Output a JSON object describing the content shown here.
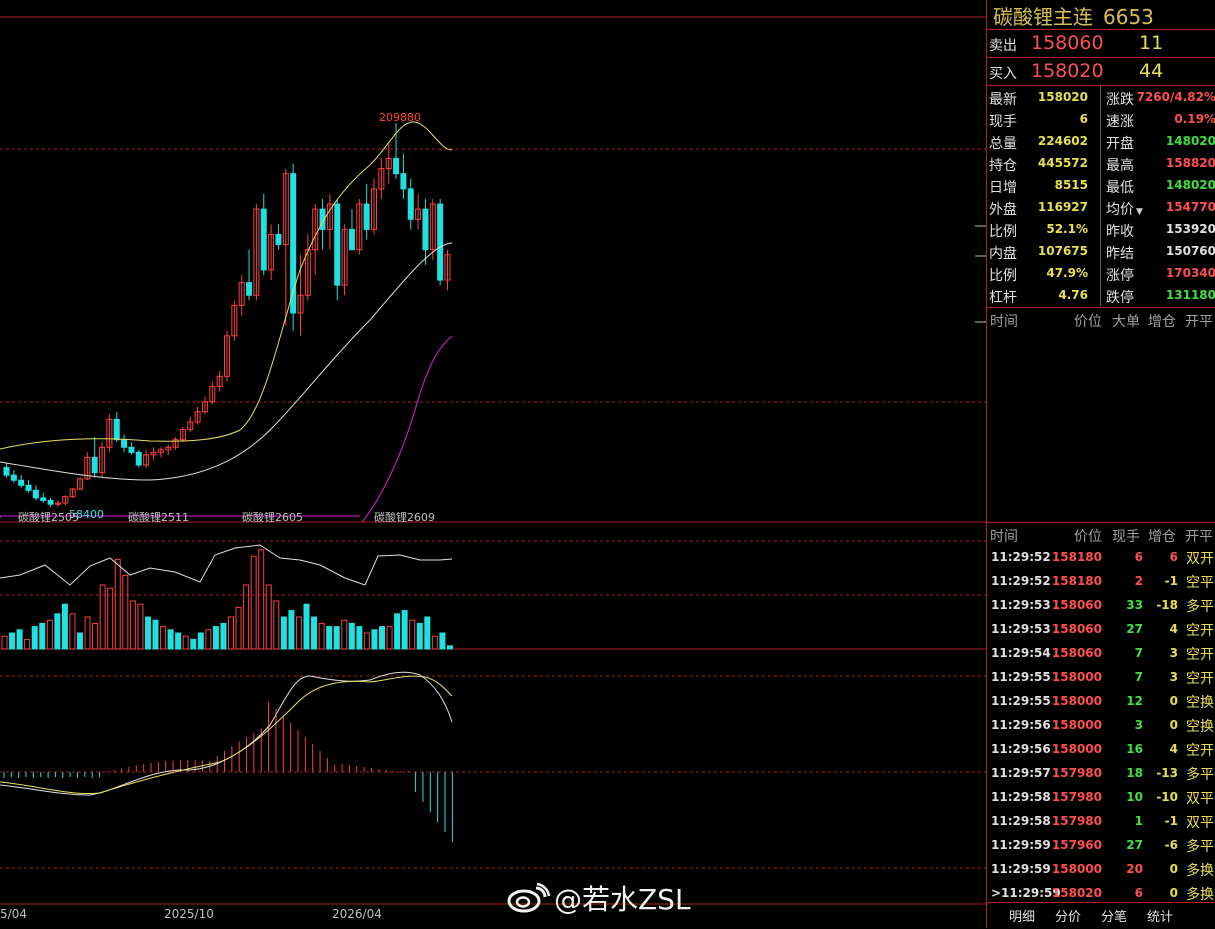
{
  "instrument": {
    "name": "碳酸锂主连",
    "code": "6653"
  },
  "bid_ask": {
    "sell": {
      "label": "卖出",
      "price": "158060",
      "volume": "11"
    },
    "buy": {
      "label": "买入",
      "price": "158020",
      "volume": "44"
    }
  },
  "quote": [
    {
      "k1": "最新",
      "v1": "158020",
      "k2": "涨跌",
      "v2": "7260/4.82%",
      "v2_color": "#ff5050"
    },
    {
      "k1": "现手",
      "v1": "6",
      "k2": "速涨",
      "v2": "0.19%",
      "v2_color": "#ff5050"
    },
    {
      "k1": "总量",
      "v1": "224602",
      "k2": "开盘",
      "v2": "148020",
      "v2_color": "#40e040"
    },
    {
      "k1": "持仓",
      "v1": "445572",
      "k2": "最高",
      "v2": "158820",
      "v2_color": "#ff5050"
    },
    {
      "k1": "日增",
      "v1": "8515",
      "k2": "最低",
      "v2": "148020",
      "v2_color": "#40e040"
    },
    {
      "k1": "外盘",
      "v1": "116927",
      "k2": "均价",
      "v2": "154770",
      "v2_color": "#ff5050",
      "dropdown": true
    },
    {
      "k1": "比例",
      "v1": "52.1%",
      "k2": "昨收",
      "v2": "153920",
      "v2_color": "#e0e0e0"
    },
    {
      "k1": "内盘",
      "v1": "107675",
      "k2": "昨结",
      "v2": "150760",
      "v2_color": "#e0e0e0"
    },
    {
      "k1": "比例",
      "v1": "47.9%",
      "k2": "涨停",
      "v2": "170340",
      "v2_color": "#ff5050"
    },
    {
      "k1": "杠杆",
      "v1": "4.76",
      "k2": "跌停",
      "v2": "131180",
      "v2_color": "#40e040"
    }
  ],
  "tick_header_top": {
    "time": "时间",
    "price": "价位",
    "big": "大单",
    "oi": "增仓",
    "type": "开平"
  },
  "tick_header": {
    "time": "时间",
    "price": "价位",
    "vol": "现手",
    "oi": "增仓",
    "type": "开平"
  },
  "trades": [
    {
      "time": "11:29:52",
      "price": "158180",
      "vol": "6",
      "oi": "6",
      "type": "双开",
      "vc": "#ff5050",
      "cc": "#ff5050",
      "tc": "#e8e050"
    },
    {
      "time": "11:29:52",
      "price": "158180",
      "vol": "2",
      "oi": "-1",
      "type": "空平",
      "vc": "#ff5050",
      "cc": "#e8e050",
      "tc": "#e8e050"
    },
    {
      "time": "11:29:53",
      "price": "158060",
      "vol": "33",
      "oi": "-18",
      "type": "多平",
      "vc": "#40e040",
      "cc": "#e8e050",
      "tc": "#e8e050"
    },
    {
      "time": "11:29:53",
      "price": "158060",
      "vol": "27",
      "oi": "4",
      "type": "空开",
      "vc": "#40e040",
      "cc": "#e8e050",
      "tc": "#e8e050"
    },
    {
      "time": "11:29:54",
      "price": "158060",
      "vol": "7",
      "oi": "3",
      "type": "空开",
      "vc": "#40e040",
      "cc": "#e8e050",
      "tc": "#e8e050"
    },
    {
      "time": "11:29:55",
      "price": "158000",
      "vol": "7",
      "oi": "3",
      "type": "空开",
      "vc": "#40e040",
      "cc": "#e8e050",
      "tc": "#e8e050"
    },
    {
      "time": "11:29:55",
      "price": "158000",
      "vol": "12",
      "oi": "0",
      "type": "空换",
      "vc": "#40e040",
      "cc": "#e8e050",
      "tc": "#e8e050"
    },
    {
      "time": "11:29:56",
      "price": "158000",
      "vol": "3",
      "oi": "0",
      "type": "空换",
      "vc": "#40e040",
      "cc": "#e8e050",
      "tc": "#e8e050"
    },
    {
      "time": "11:29:56",
      "price": "158000",
      "vol": "16",
      "oi": "4",
      "type": "空开",
      "vc": "#40e040",
      "cc": "#e8e050",
      "tc": "#e8e050"
    },
    {
      "time": "11:29:57",
      "price": "157980",
      "vol": "18",
      "oi": "-13",
      "type": "多平",
      "vc": "#40e040",
      "cc": "#e8e050",
      "tc": "#e8e050"
    },
    {
      "time": "11:29:58",
      "price": "157980",
      "vol": "10",
      "oi": "-10",
      "type": "双平",
      "vc": "#40e040",
      "cc": "#e8e050",
      "tc": "#e8e050"
    },
    {
      "time": "11:29:58",
      "price": "157980",
      "vol": "1",
      "oi": "-1",
      "type": "双平",
      "vc": "#40e040",
      "cc": "#e8e050",
      "tc": "#e8e050"
    },
    {
      "time": "11:29:59",
      "price": "157960",
      "vol": "27",
      "oi": "-6",
      "type": "多平",
      "vc": "#40e040",
      "cc": "#e8e050",
      "tc": "#e8e050"
    },
    {
      "time": "11:29:59",
      "price": "158000",
      "vol": "20",
      "oi": "0",
      "type": "多换",
      "vc": "#ff5050",
      "cc": "#e8e050",
      "tc": "#e8e050"
    },
    {
      "time": ">11:29:59",
      "price": "158020",
      "vol": "6",
      "oi": "0",
      "type": "多换",
      "vc": "#ff5050",
      "cc": "#e8e050",
      "tc": "#e8e050"
    }
  ],
  "tabs": [
    "明细",
    "分价",
    "分笔",
    "统计"
  ],
  "chart": {
    "peak_label": "209880",
    "low_label": "58400",
    "contract_labels": [
      "碳酸锂2505",
      "碳酸锂2511",
      "碳酸锂2605",
      "碳酸锂2609"
    ],
    "x_dates": [
      "5/04",
      "2025/10",
      "2026/04"
    ]
  },
  "watermark": "@若水ZSL",
  "colors": {
    "up": "#ff4040",
    "down": "#20e0e0",
    "grid": "#b02020",
    "ma_yellow": "#e8e060",
    "ma_white": "#e0e0e0",
    "ma_magenta": "#e020e0"
  }
}
